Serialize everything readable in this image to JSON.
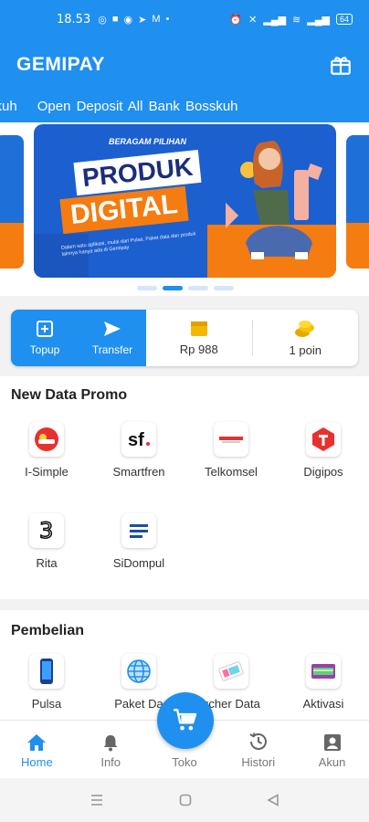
{
  "status_bar": {
    "time": "18.53",
    "battery": "64"
  },
  "app_bar": {
    "title": "GEMIPAY"
  },
  "marquee": {
    "text_1": "All Bank Bosskuh",
    "text_2": "Open Deposit All Bank Bosskuh"
  },
  "banner": {
    "kicker": "BERAGAM PILIHAN",
    "word_1": "PRODUK",
    "word_2": "DIGITAL",
    "description": "Dalam satu aplikasi, mulai dari Pulsa, Paket data dan produk lainnya hanya ada di Gemipay",
    "active_slide": 2,
    "slide_count": 4
  },
  "wallet": {
    "topup_label": "Topup",
    "transfer_label": "Transfer",
    "balance": "Rp 988",
    "points": "1 poin"
  },
  "promo": {
    "title": "New Data Promo",
    "items": [
      {
        "label": "I-Simple",
        "icon": "indosat-logo-icon"
      },
      {
        "label": "Smartfren",
        "icon": "smartfren-logo-icon"
      },
      {
        "label": "Telkomsel",
        "icon": "digipos-logo-icon"
      },
      {
        "label": "Digipos",
        "icon": "telkomsel-logo-icon"
      },
      {
        "label": "Rita",
        "icon": "three-logo-icon"
      },
      {
        "label": "SiDompul",
        "icon": "dompul-logo-icon"
      }
    ]
  },
  "purchase": {
    "title": "Pembelian",
    "items": [
      {
        "label": "Pulsa",
        "icon": "phone-icon"
      },
      {
        "label": "Paket Da",
        "icon": "globe-icon"
      },
      {
        "label": "ucher Data",
        "icon": "voucher-icon"
      },
      {
        "label": "Aktivasi",
        "icon": "activation-card-icon"
      }
    ]
  },
  "bottom_nav": {
    "home": "Home",
    "info": "Info",
    "toko": "Toko",
    "histori": "Histori",
    "akun": "Akun"
  },
  "colors": {
    "primary": "#1f8ff0",
    "orange": "#f57c10",
    "banner_blue": "#1c5fcf"
  }
}
